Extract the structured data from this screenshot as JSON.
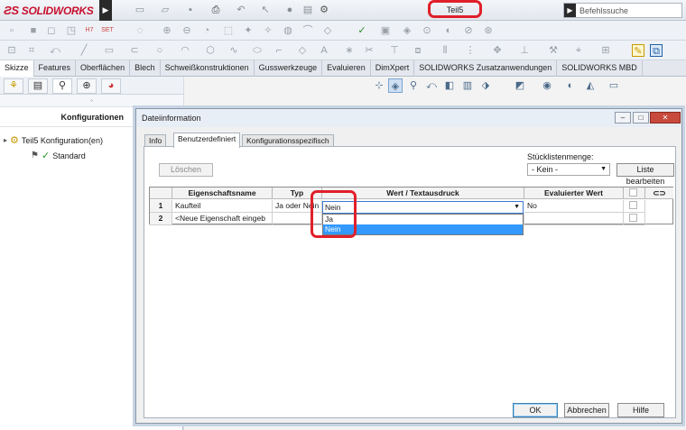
{
  "app": {
    "brand": "SOLIDWORKS",
    "document_title": "Teil5"
  },
  "search": {
    "placeholder": "Befehlssuche"
  },
  "ribbon_tabs": [
    "Skizze",
    "Features",
    "Oberflächen",
    "Blech",
    "Schweißkonstruktionen",
    "Gusswerkzeuge",
    "Evaluieren",
    "DimXpert",
    "SOLIDWORKS Zusatzanwendungen",
    "SOLIDWORKS MBD"
  ],
  "ribbon_active_tab": "Skizze",
  "left_panel": {
    "header": "Konfigurationen",
    "tree_root": "Teil5 Konfiguration(en)",
    "tree_child": "Standard"
  },
  "dialog": {
    "title": "Dateiinformation",
    "tabs": [
      "Info",
      "Benutzerdefiniert",
      "Konfigurationsspezifisch"
    ],
    "active_tab": "Benutzerdefiniert",
    "delete_button": "Löschen",
    "bom_qty_label": "Stücklistenmenge:",
    "bom_qty_value": "- Kein -",
    "edit_list_button": "Liste bearbeiten",
    "table": {
      "headers": [
        "Eigenschaftsname",
        "Typ",
        "Wert / Textausdruck",
        "Evaluierter Wert"
      ],
      "rows": [
        {
          "num": "1",
          "name": "Kaufteil",
          "type": "Ja oder Nein",
          "value": "Nein",
          "evaluated": "No"
        },
        {
          "num": "2",
          "name": "<Neue Eigenschaft eingeb",
          "type": "",
          "value": "",
          "evaluated": ""
        }
      ]
    },
    "dropdown_options": [
      "Ja",
      "Nein"
    ],
    "dropdown_selected": "Nein",
    "ok_button": "OK",
    "cancel_button": "Abbrechen",
    "help_button": "Hilfe"
  },
  "colors": {
    "highlight": "#e0202a",
    "brand": "#c8102e",
    "selection": "#3399ff"
  }
}
